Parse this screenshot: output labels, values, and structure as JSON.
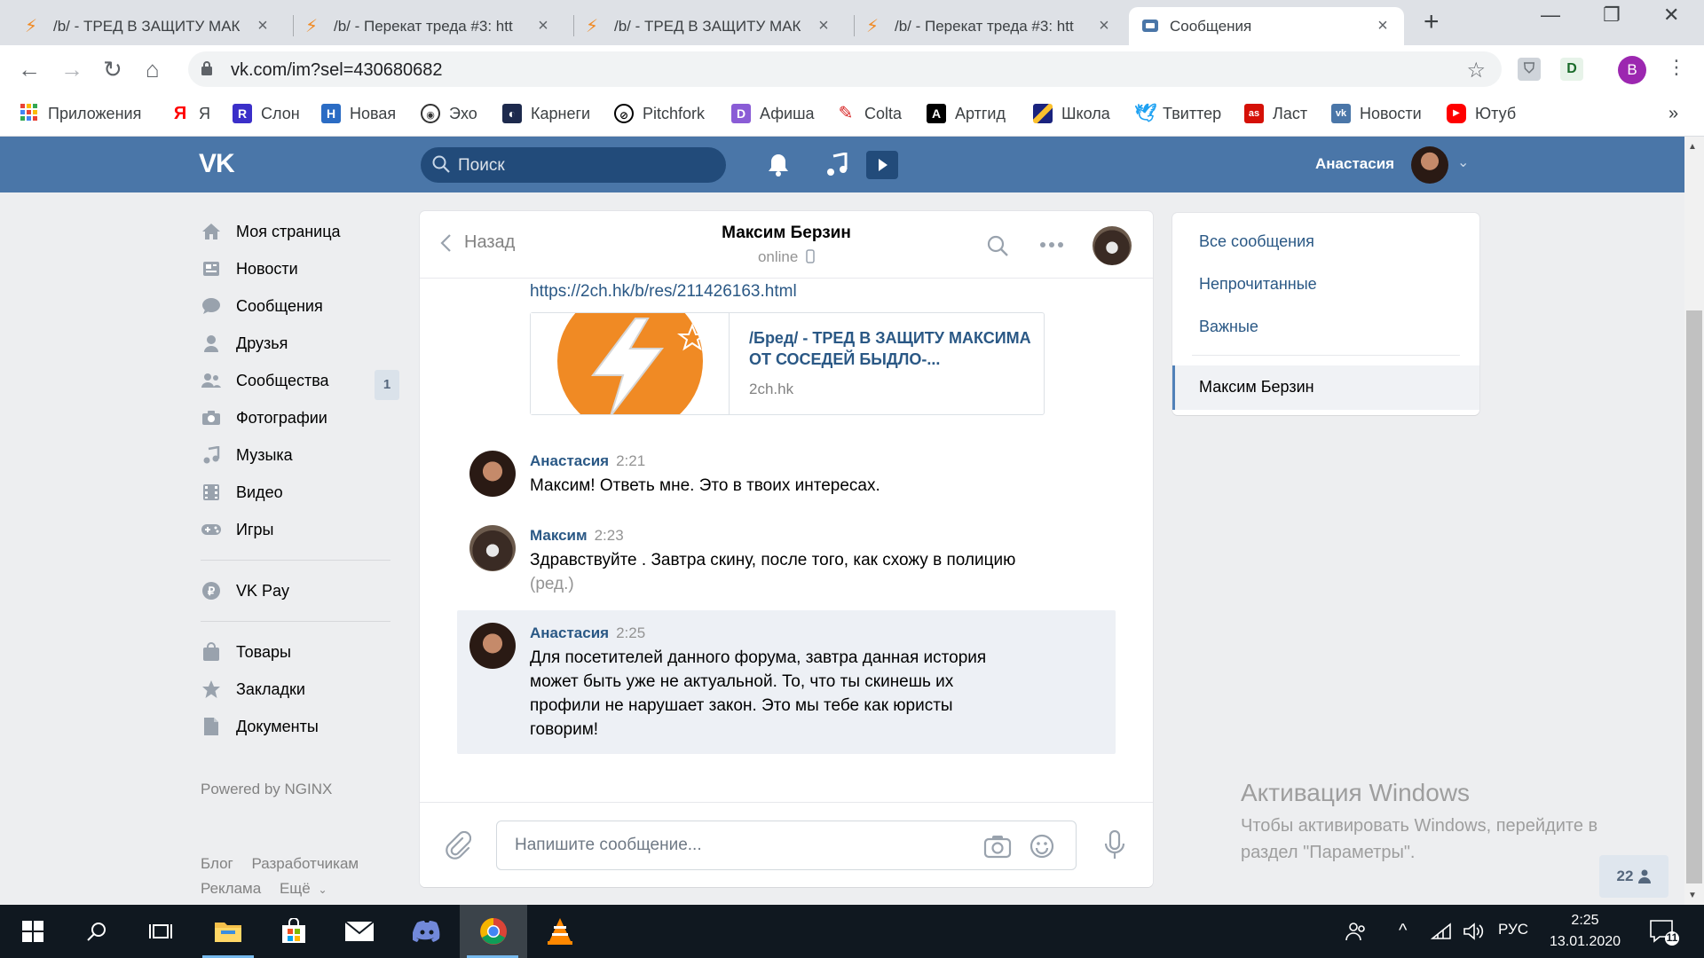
{
  "browser": {
    "tabs": [
      {
        "title": "/b/ - ТРЕД В ЗАЩИТУ МАК",
        "active": false
      },
      {
        "title": "/b/ - Перекат треда #3: htt",
        "active": false
      },
      {
        "title": "/b/ - ТРЕД В ЗАЩИТУ МАК",
        "active": false
      },
      {
        "title": "/b/ - Перекат треда #3: htt",
        "active": false
      },
      {
        "title": "Сообщения",
        "active": true
      }
    ],
    "url": "vk.com/im?sel=430680682",
    "profile_initial": "B",
    "bookmarks": [
      {
        "label": "Приложения",
        "icon": "apps-grid-icon",
        "color": "#e94235"
      },
      {
        "label": "Я",
        "icon": "yandex-icon",
        "color": "#ff0000"
      },
      {
        "label": "Слон",
        "icon": "slon-icon",
        "color": "#3b2fc9"
      },
      {
        "label": "Новая",
        "icon": "novaya-icon",
        "color": "#2b6cc4"
      },
      {
        "label": "Эхо",
        "icon": "echo-icon",
        "color": "#333333"
      },
      {
        "label": "Карнеги",
        "icon": "carnegie-icon",
        "color": "#1d2a4d"
      },
      {
        "label": "Pitchfork",
        "icon": "pitchfork-icon",
        "color": "#000000"
      },
      {
        "label": "Афиша",
        "icon": "afisha-icon",
        "color": "#8a5cd6"
      },
      {
        "label": "Colta",
        "icon": "colta-icon",
        "color": "#d62020"
      },
      {
        "label": "Артгид",
        "icon": "artgid-icon",
        "color": "#000000"
      },
      {
        "label": "Школа",
        "icon": "school-icon",
        "color": "#1a237e"
      },
      {
        "label": "Твиттер",
        "icon": "twitter-icon",
        "color": "#1da1f2"
      },
      {
        "label": "Ласт",
        "icon": "lastfm-icon",
        "color": "#d51007"
      },
      {
        "label": "Новости",
        "icon": "vk-icon",
        "color": "#4a76a8"
      },
      {
        "label": "Ютуб",
        "icon": "youtube-icon",
        "color": "#ff0000"
      }
    ]
  },
  "vk": {
    "logo": "VK",
    "search_placeholder": "Поиск",
    "user_name": "Анастасия",
    "menu": [
      {
        "label": "Моя страница",
        "icon": "home-icon"
      },
      {
        "label": "Новости",
        "icon": "news-icon"
      },
      {
        "label": "Сообщения",
        "icon": "messages-icon"
      },
      {
        "label": "Друзья",
        "icon": "friends-icon"
      },
      {
        "label": "Сообщества",
        "icon": "communities-icon",
        "count": "1"
      },
      {
        "label": "Фотографии",
        "icon": "camera-icon"
      },
      {
        "label": "Музыка",
        "icon": "music-icon"
      },
      {
        "label": "Видео",
        "icon": "video-icon"
      },
      {
        "label": "Игры",
        "icon": "gamepad-icon"
      }
    ],
    "menu2": [
      {
        "label": "VK Pay",
        "icon": "ruble-icon"
      }
    ],
    "menu3": [
      {
        "label": "Товары",
        "icon": "bag-icon"
      },
      {
        "label": "Закладки",
        "icon": "star-icon"
      },
      {
        "label": "Документы",
        "icon": "document-icon"
      }
    ],
    "powered": "Powered by NGINX",
    "footer": {
      "blog": "Блог",
      "dev": "Разработчикам",
      "ads": "Реклама",
      "more": "Ещё"
    }
  },
  "chat": {
    "back_label": "Назад",
    "peer_name": "Максим Берзин",
    "peer_status": "online",
    "link": "https://2ch.hk/b/res/211426163.html",
    "card": {
      "title": "/Бред/ - ТРЕД В ЗАЩИТУ МАКСИМА ОТ СОСЕДЕЙ БЫДЛО-...",
      "domain": "2ch.hk"
    },
    "messages": [
      {
        "author": "Анастасия",
        "time": "2:21",
        "lines": [
          "Максим! Ответь мне. Это в твоих интересах."
        ]
      },
      {
        "author": "Максим",
        "time": "2:23",
        "lines": [
          "Здравствуйте . Завтра скину, после того, как схожу в полицию"
        ],
        "edited": "(ред.)"
      },
      {
        "author": "Анастасия",
        "time": "2:25",
        "lines": [
          "Для посетителей данного форума, завтра данная история",
          "может быть уже не актуальной. То, что ты скинешь их",
          "профили не нарушает закон. Это мы тебе как юристы",
          "говорим!"
        ],
        "highlighted": true
      }
    ],
    "composer_placeholder": "Напишите сообщение..."
  },
  "right_panel": {
    "all": "Все сообщения",
    "unread": "Непрочитанные",
    "important": "Важные",
    "active_chat": "Максим Берзин"
  },
  "activation": {
    "title": "Активация Windows",
    "text": "Чтобы активировать Windows, перейдите в раздел \"Параметры\"."
  },
  "online_count": "22",
  "taskbar": {
    "language": "РУС",
    "time": "2:25",
    "date": "13.01.2020",
    "notifications": "11"
  },
  "colors": {
    "vk_blue": "#4a76a8",
    "link": "#2a5885",
    "accent_2ch": "#f08a24"
  }
}
